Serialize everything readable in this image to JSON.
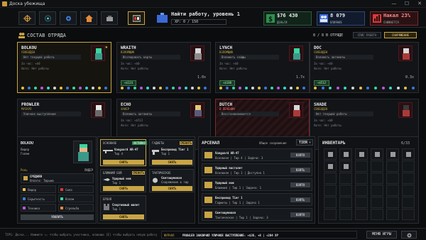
{
  "window": {
    "title": "Доска убежища",
    "minimize": "—",
    "maximize": "☐",
    "close": "✕"
  },
  "topbar": {
    "job_title": "Найти работу, уровень 1",
    "xp": "XP: 0 / 150",
    "money_value": "$76 430",
    "money_label": "ДЕНЬГИ",
    "people_value": "8 079",
    "people_label": "ВЛИЯНИЕ",
    "heat_value": "Накал 23%",
    "heat_label": "СНИЖАЕТСЯ",
    "colors": {
      "money": "#2f8f4e",
      "people": "#3a6ad6",
      "heat": "#d63a3a"
    }
  },
  "squad": {
    "title": "СОСТАВ ОТРЯДА",
    "count": "8 / 8 В ОТРЯДЕ",
    "btn_sort": "СПИС РАБОТА",
    "btn_equip": "СНАРЯЖЕНИЕ"
  },
  "cards": [
    {
      "name": "BOLKOU",
      "status": "СВОБОДЕН",
      "desc": "Нет текущей работы",
      "rate": "За час: +$0",
      "rate2": "Авто: Нет работы",
      "star": "★",
      "earn": "",
      "mult": "",
      "hair": "#3ad6a0",
      "shirt": "#3a9a8a"
    },
    {
      "name": "WRAITH",
      "status": "ВЗЛОМЩИК",
      "desc": "Исследовать карты",
      "rate": "За час: +$0",
      "rate2": "Авто: Нет работы",
      "star": "",
      "earn": "+$124",
      "mult": "1.0x",
      "hair": "#d8d8d8",
      "shirt": "#8a8a8a"
    },
    {
      "name": "LYNCH",
      "status": "ВЗЛОМЩИК",
      "desc": "Взломать сейфы",
      "rate": "За час: +$0",
      "rate2": "Авто: Нет работы",
      "star": "",
      "earn": "+$180",
      "mult": "1.7x",
      "hair": "#3ad6a0",
      "shirt": "#3a9a8a"
    },
    {
      "name": "DOC",
      "status": "СВОБОДЕН",
      "desc": "Взломать автоматы",
      "rate": "За час: +$0",
      "rate2": "Авто: Нет работы",
      "star": "",
      "earn": "+$512",
      "mult": "0.3x",
      "hair": "#d8d8d8",
      "shirt": "#aa3a3a"
    },
    {
      "name": "PROWLER",
      "status": "МУСКУЛ",
      "desc": "Уличное выступление",
      "rate": "",
      "rate2": "",
      "star": "",
      "earn": "",
      "mult": "",
      "hair": "#e8e8e8",
      "shirt": "#6a6a6a"
    },
    {
      "name": "ECHO",
      "status": "ХАКЕР",
      "desc": "Взломать автоматы",
      "rate": "За час: +$512",
      "rate2": "Авто: Нет работы",
      "star": "",
      "earn": "",
      "mult": "",
      "hair": "#e0c878",
      "shirt": "#5a5a7a"
    },
    {
      "name": "DUTCH",
      "status": "В ЛЕЧЕНИИ",
      "desc": "Восстанавливается",
      "rate": "",
      "rate2": "",
      "star": "",
      "earn": "",
      "mult": "",
      "hair": "#d8d8d8",
      "shirt": "#aa3a3a"
    },
    {
      "name": "SHADE",
      "status": "СВОБОДЕН",
      "desc": "Нет текущей работы",
      "rate": "За час: +$0",
      "rate2": "Авто: Нет работы",
      "star": "",
      "earn": "",
      "mult": "",
      "hair": "#3a3a3a",
      "shirt": "#aa3a3a"
    }
  ],
  "detail": {
    "name": "BOLKOU",
    "role": "Лидер",
    "sub": "Голем",
    "skill_head": "Роль",
    "skill_head2": "ЛИДЕР",
    "mod_title": "СРЕДНЯЯ",
    "mod_sub": "Оплата: Тюрьма",
    "stats": [
      "Лидер",
      "Сила",
      "Скрытность",
      "Взлом",
      "Техника",
      "Стрельба"
    ],
    "dismiss": "УВОЛИТЬ"
  },
  "equip": {
    "main_label": "ОСНОВНОЕ",
    "main_badge": "АКТИВНО",
    "main_item": "Vanguard AR-47",
    "main_tier": "Тир 4",
    "main_btn": "СНЯТЬ",
    "melee_label": "БЛИЖНИЙ БОЙ",
    "melee_btn2": "СМЕНИТЬ",
    "melee_item": "Ударный нож",
    "melee_tier": "Тир 1",
    "melee_btn": "СНЯТЬ",
    "armor_label": "БРОНЯ",
    "armor_item": "Спортивный жилет",
    "armor_tier": "Тир 1",
    "armor_btn": "СНЯТЬ",
    "gadget_label": "ГАДЖЕТЫ",
    "gadget_btn2": "СМЕНИТЬ",
    "gadget_item": "Беспровод Tier 1",
    "gadget_tier": "Тир 1",
    "gadget_btn": "СНЯТЬ",
    "tact_label": "ТАКТИЧЕСКОЕ",
    "tact_item": "Светошумовая",
    "tact_tier": "Снаряжение в тир",
    "tact_btn": "СНЯТЬ"
  },
  "arsenal": {
    "title": "АРСЕНАЛ",
    "filter": "Общее снаряжение",
    "tier": "TIER",
    "items": [
      {
        "name": "Vanguard AR-47",
        "sub": "Основное | Тир 4 | Задача: 3",
        "btn": "ВЗЯТО"
      },
      {
        "name": "Ударный пистолет",
        "sub": "Основное | Тир 1 | Доступно 1",
        "btn": "ВЗЯТЬ"
      },
      {
        "name": "Ударный нож",
        "sub": "Ближний | Тир 1 | Задача: 1",
        "btn": "ВЗЯТО"
      },
      {
        "name": "Беспровод Tier 1",
        "sub": "Гаджеты | Тир 1 | Задача 1",
        "btn": "ВЗЯТЬ"
      },
      {
        "name": "Светошумовая",
        "sub": "Тактическое | Тир 1 | Задача: 3",
        "btn": "ВЗЯТО"
      }
    ]
  },
  "inventory": {
    "title": "ИНВЕНТАРЬ",
    "count": "6/33"
  },
  "bottom": {
    "hint": "TIPS: Доска... Нажмите ↑↓ чтобы выбрать участника, клавиша [E] чтобы выбрать новую работу",
    "log_tag": "ЖУРНАЛ",
    "log": "PROWLER ЗАКОНЧИЛ УЛИЧНОЕ ВЫСТУПЛЕНИЕ: +$36, +8 | +204 XP",
    "menu": "МЕНЮ ИГРЫ"
  }
}
